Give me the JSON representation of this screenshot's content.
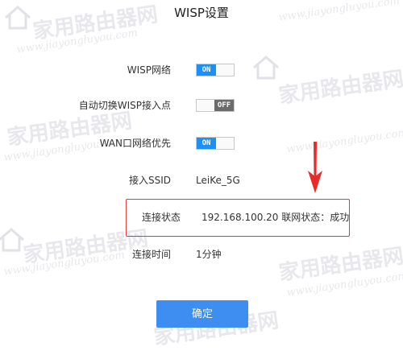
{
  "page": {
    "title": "WISP设置"
  },
  "settings": {
    "wisp_network": {
      "label": "WISP网络",
      "toggle": "ON"
    },
    "auto_switch": {
      "label": "自动切换WISP接入点",
      "toggle": "OFF"
    },
    "wan_priority": {
      "label": "WAN口网络优先",
      "toggle": "ON"
    },
    "ssid": {
      "label": "接入SSID",
      "value": "LeiKe_5G"
    },
    "status": {
      "label": "连接状态",
      "value": "192.168.100.20  联网状态：成功"
    },
    "time": {
      "label": "连接时间",
      "value": "1分钟"
    }
  },
  "actions": {
    "confirm_label": "确定"
  },
  "watermark": {
    "brand": "家用路由器网",
    "url": "www.jiayongluyou.com"
  },
  "colors": {
    "toggle_on": "#1e8ff5",
    "toggle_off": "#6b6b6b",
    "primary_button": "#3d8ef0",
    "highlight": "#e03a3a"
  }
}
